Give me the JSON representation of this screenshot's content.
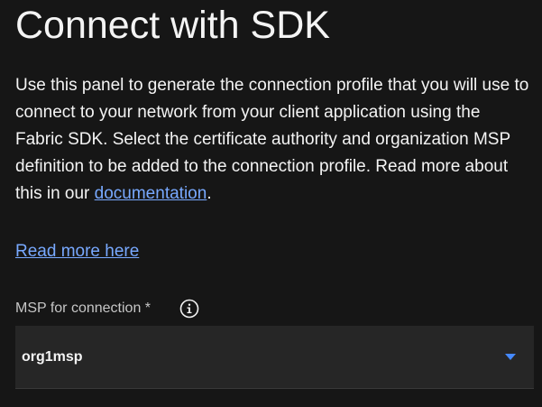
{
  "panel": {
    "title": "Connect with SDK",
    "description_text": "Use this panel to generate the connection profile that you will use to connect to your network from your client application using the Fabric SDK. Select the certificate authority and organization MSP definition to be added to the connection profile. Read more about this in our ",
    "description_link": "documentation",
    "description_end": ".",
    "read_more_link": "Read more here"
  },
  "msp_field": {
    "label": "MSP for connection *",
    "info_icon": "info-icon",
    "selected_value": "org1msp",
    "dropdown_icon": "caret-down-icon"
  },
  "colors": {
    "background": "#161616",
    "text": "#f4f4f4",
    "link": "#78a9ff",
    "field_bg": "#262626",
    "accent": "#4589ff"
  }
}
